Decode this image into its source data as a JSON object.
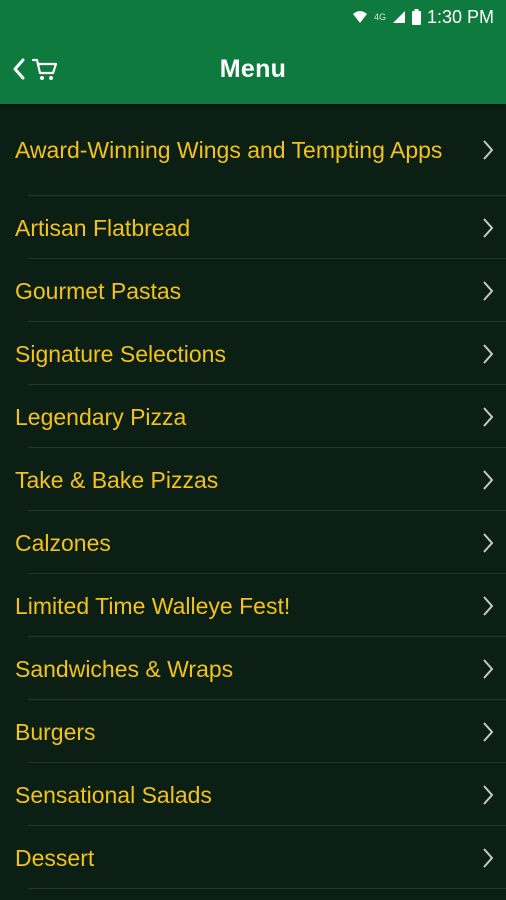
{
  "status_bar": {
    "time": "1:30 PM",
    "network": "4G"
  },
  "header": {
    "title": "Menu"
  },
  "menu": {
    "items": [
      {
        "label": "Award-Winning Wings and Tempting Apps"
      },
      {
        "label": "Artisan Flatbread"
      },
      {
        "label": "Gourmet Pastas"
      },
      {
        "label": "Signature Selections"
      },
      {
        "label": "Legendary Pizza"
      },
      {
        "label": "Take & Bake Pizzas"
      },
      {
        "label": "Calzones"
      },
      {
        "label": "Limited Time Walleye Fest!"
      },
      {
        "label": "Sandwiches & Wraps"
      },
      {
        "label": "Burgers"
      },
      {
        "label": "Sensational Salads"
      },
      {
        "label": "Dessert"
      }
    ]
  },
  "colors": {
    "brand_green": "#0f7a3e",
    "background": "#0b1f14",
    "accent_gold": "#f3c21c",
    "divider": "#21392b"
  }
}
